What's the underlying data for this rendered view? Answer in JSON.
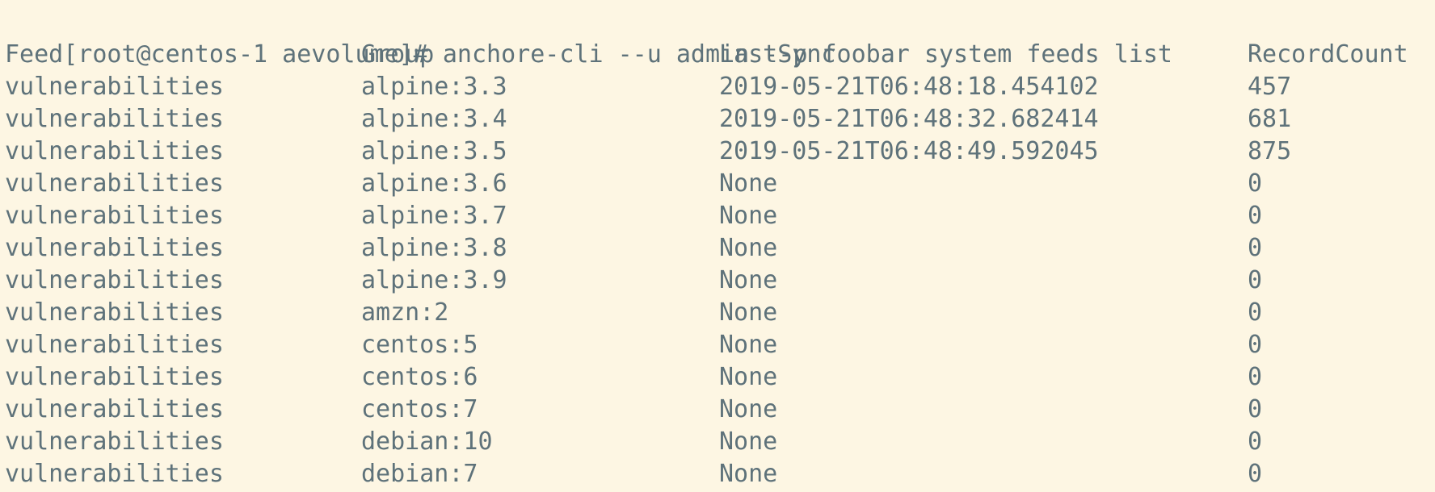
{
  "terminal": {
    "prompt": "[root@centos-1 aevolume]#",
    "command": "anchore-cli --u admin --p foobar system feeds list"
  },
  "table": {
    "headers": [
      "Feed",
      "Group",
      "LastSync",
      "RecordCount"
    ],
    "rows": [
      [
        "vulnerabilities",
        "alpine:3.3",
        "2019-05-21T06:48:18.454102",
        "457"
      ],
      [
        "vulnerabilities",
        "alpine:3.4",
        "2019-05-21T06:48:32.682414",
        "681"
      ],
      [
        "vulnerabilities",
        "alpine:3.5",
        "2019-05-21T06:48:49.592045",
        "875"
      ],
      [
        "vulnerabilities",
        "alpine:3.6",
        "None",
        "0"
      ],
      [
        "vulnerabilities",
        "alpine:3.7",
        "None",
        "0"
      ],
      [
        "vulnerabilities",
        "alpine:3.8",
        "None",
        "0"
      ],
      [
        "vulnerabilities",
        "alpine:3.9",
        "None",
        "0"
      ],
      [
        "vulnerabilities",
        "amzn:2",
        "None",
        "0"
      ],
      [
        "vulnerabilities",
        "centos:5",
        "None",
        "0"
      ],
      [
        "vulnerabilities",
        "centos:6",
        "None",
        "0"
      ],
      [
        "vulnerabilities",
        "centos:7",
        "None",
        "0"
      ],
      [
        "vulnerabilities",
        "debian:10",
        "None",
        "0"
      ],
      [
        "vulnerabilities",
        "debian:7",
        "None",
        "0"
      ]
    ]
  },
  "colors": {
    "background": "#fdf6e3",
    "text": "#5e727a"
  }
}
